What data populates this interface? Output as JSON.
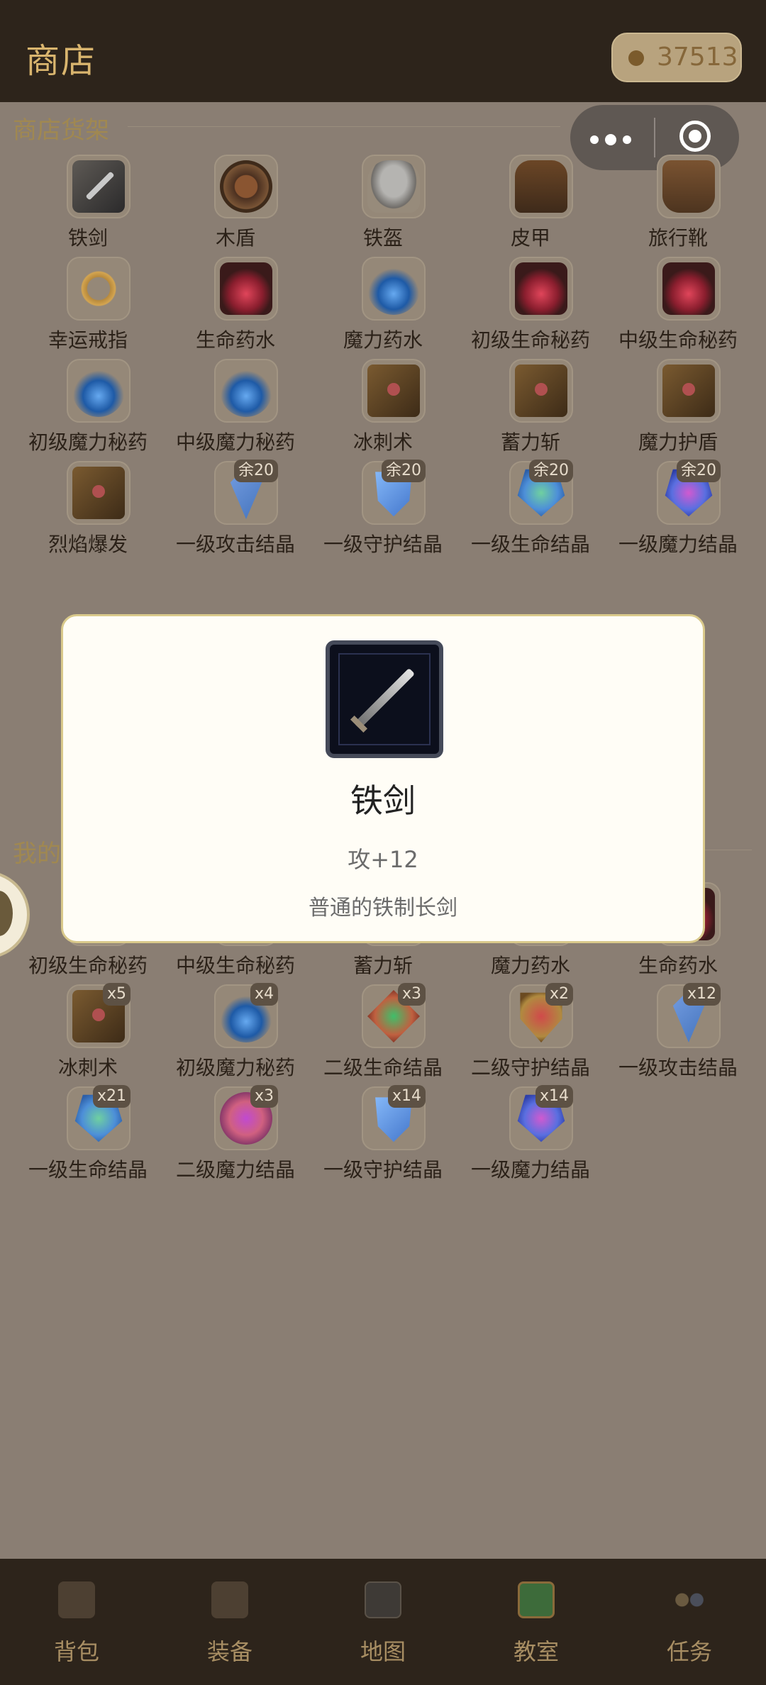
{
  "header": {
    "title": "商店",
    "gold": "37513"
  },
  "shop": {
    "title": "商店货架",
    "items": [
      {
        "name": "铁剑",
        "art": "sword",
        "stock": ""
      },
      {
        "name": "木盾",
        "art": "shield",
        "stock": ""
      },
      {
        "name": "铁盔",
        "art": "helmet",
        "stock": ""
      },
      {
        "name": "皮甲",
        "art": "armor",
        "stock": ""
      },
      {
        "name": "旅行靴",
        "art": "boots",
        "stock": ""
      },
      {
        "name": "幸运戒指",
        "art": "ring",
        "stock": ""
      },
      {
        "name": "生命药水",
        "art": "red",
        "stock": ""
      },
      {
        "name": "魔力药水",
        "art": "blue",
        "stock": ""
      },
      {
        "name": "初级生命秘药",
        "art": "red",
        "stock": ""
      },
      {
        "name": "中级生命秘药",
        "art": "red",
        "stock": ""
      },
      {
        "name": "初级魔力秘药",
        "art": "blue",
        "stock": ""
      },
      {
        "name": "中级魔力秘药",
        "art": "blue",
        "stock": ""
      },
      {
        "name": "冰刺术",
        "art": "book",
        "stock": ""
      },
      {
        "name": "蓄力斩",
        "art": "book",
        "stock": ""
      },
      {
        "name": "魔力护盾",
        "art": "book",
        "stock": ""
      },
      {
        "name": "烈焰爆发",
        "art": "book",
        "stock": ""
      },
      {
        "name": "一级攻击结晶",
        "art": "crystal-red",
        "stock": "余20"
      },
      {
        "name": "一级守护结晶",
        "art": "crystal-blue",
        "stock": "余20"
      },
      {
        "name": "一级生命结晶",
        "art": "crystal-green",
        "stock": "余20"
      },
      {
        "name": "一级魔力结晶",
        "art": "crystal-purple",
        "stock": "余20"
      }
    ]
  },
  "bag": {
    "title": "我的",
    "items": [
      {
        "name": "初级生命秘药",
        "art": "red",
        "count": ""
      },
      {
        "name": "中级生命秘药",
        "art": "red",
        "count": ""
      },
      {
        "name": "蓄力斩",
        "art": "book",
        "count": ""
      },
      {
        "name": "魔力药水",
        "art": "blue",
        "count": ""
      },
      {
        "name": "生命药水",
        "art": "red",
        "count": ""
      },
      {
        "name": "冰刺术",
        "art": "book",
        "count": "x5"
      },
      {
        "name": "初级魔力秘药",
        "art": "blue",
        "count": "x4"
      },
      {
        "name": "二级生命结晶",
        "art": "gem-green",
        "count": "x3"
      },
      {
        "name": "二级守护结晶",
        "art": "shield-red",
        "count": "x2"
      },
      {
        "name": "一级攻击结晶",
        "art": "crystal-red",
        "count": "x12"
      },
      {
        "name": "一级生命结晶",
        "art": "crystal-green",
        "count": "x21"
      },
      {
        "name": "二级魔力结晶",
        "art": "gem-purple",
        "count": "x3"
      },
      {
        "name": "一级守护结晶",
        "art": "crystal-blue",
        "count": "x14"
      },
      {
        "name": "一级魔力结晶",
        "art": "crystal-purple",
        "count": "x14"
      }
    ]
  },
  "modal": {
    "name": "铁剑",
    "stat": "攻+12",
    "desc": "普通的铁制长剑"
  },
  "tabs": [
    {
      "label": "背包",
      "icon": "bag-icon"
    },
    {
      "label": "装备",
      "icon": "equipment-icon"
    },
    {
      "label": "地图",
      "icon": "map-icon"
    },
    {
      "label": "教室",
      "icon": "classroom-icon"
    },
    {
      "label": "任务",
      "icon": "quest-icon"
    }
  ]
}
